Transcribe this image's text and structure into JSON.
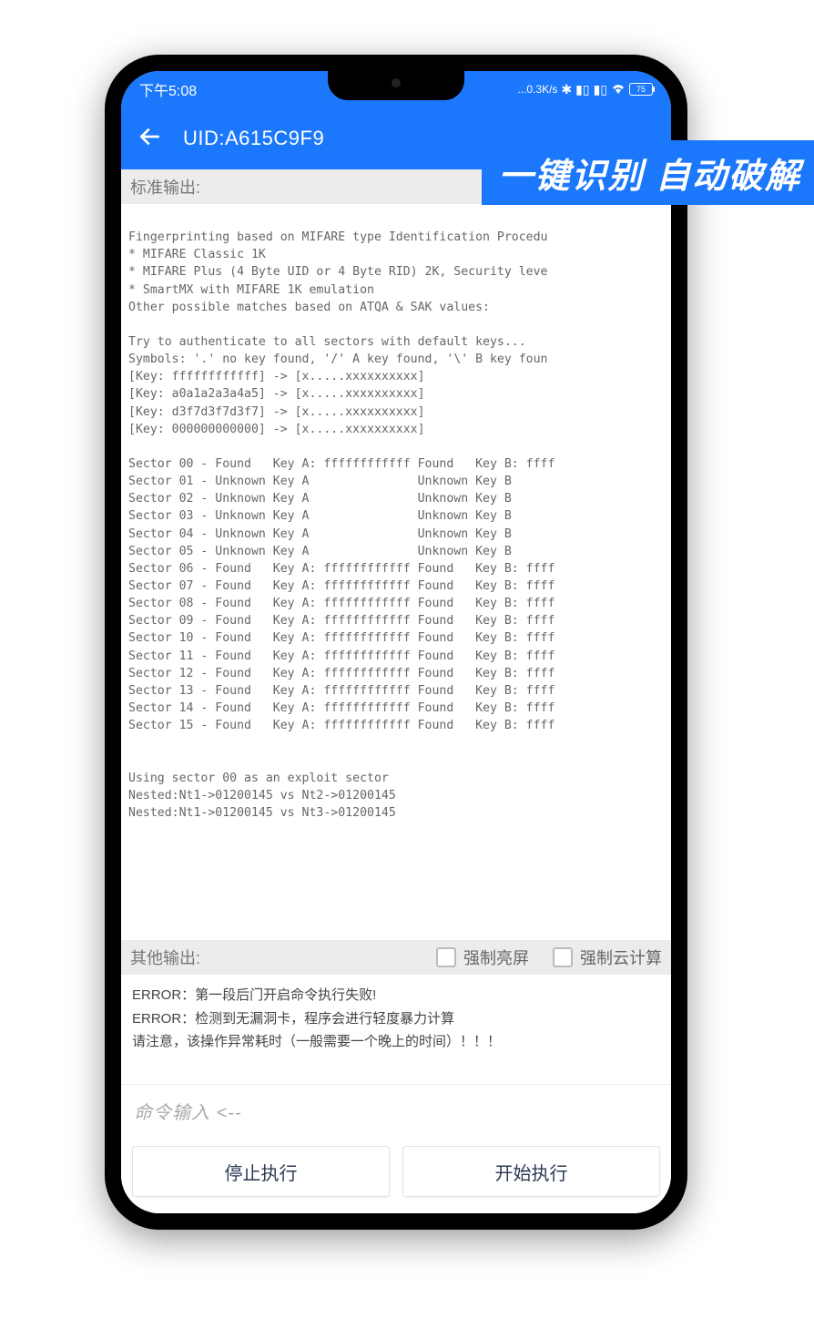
{
  "status": {
    "time": "下午5:08",
    "net_speed": "...0.3K/s",
    "battery": "75"
  },
  "app": {
    "title": "UID:A615C9F9"
  },
  "overlay": "一键识别 自动破解",
  "sections": {
    "stdout_label": "标准输出:",
    "other_label": "其他输出:",
    "opt_bright": "强制亮屏",
    "opt_cloud": "强制云计算"
  },
  "console_text": "\nFingerprinting based on MIFARE type Identification Procedu\n* MIFARE Classic 1K\n* MIFARE Plus (4 Byte UID or 4 Byte RID) 2K, Security leve\n* SmartMX with MIFARE 1K emulation\nOther possible matches based on ATQA & SAK values:\n\nTry to authenticate to all sectors with default keys...\nSymbols: '.' no key found, '/' A key found, '\\' B key foun\n[Key: ffffffffffff] -> [x.....xxxxxxxxxx]\n[Key: a0a1a2a3a4a5] -> [x.....xxxxxxxxxx]\n[Key: d3f7d3f7d3f7] -> [x.....xxxxxxxxxx]\n[Key: 000000000000] -> [x.....xxxxxxxxxx]\n\nSector 00 - Found   Key A: ffffffffffff Found   Key B: ffff\nSector 01 - Unknown Key A               Unknown Key B\nSector 02 - Unknown Key A               Unknown Key B\nSector 03 - Unknown Key A               Unknown Key B\nSector 04 - Unknown Key A               Unknown Key B\nSector 05 - Unknown Key A               Unknown Key B\nSector 06 - Found   Key A: ffffffffffff Found   Key B: ffff\nSector 07 - Found   Key A: ffffffffffff Found   Key B: ffff\nSector 08 - Found   Key A: ffffffffffff Found   Key B: ffff\nSector 09 - Found   Key A: ffffffffffff Found   Key B: ffff\nSector 10 - Found   Key A: ffffffffffff Found   Key B: ffff\nSector 11 - Found   Key A: ffffffffffff Found   Key B: ffff\nSector 12 - Found   Key A: ffffffffffff Found   Key B: ffff\nSector 13 - Found   Key A: ffffffffffff Found   Key B: ffff\nSector 14 - Found   Key A: ffffffffffff Found   Key B: ffff\nSector 15 - Found   Key A: ffffffffffff Found   Key B: ffff\n\n\nUsing sector 00 as an exploit sector\nNested:Nt1->01200145 vs Nt2->01200145\nNested:Nt1->01200145 vs Nt3->01200145",
  "other_output": [
    "ERROR：第一段后门开启命令执行失败!",
    "ERROR：检测到无漏洞卡，程序会进行轻度暴力计算",
    "请注意，该操作异常耗时（一般需要一个晚上的时间）！！！"
  ],
  "cmd_placeholder": "命令输入 <--",
  "buttons": {
    "stop": "停止执行",
    "start": "开始执行"
  }
}
